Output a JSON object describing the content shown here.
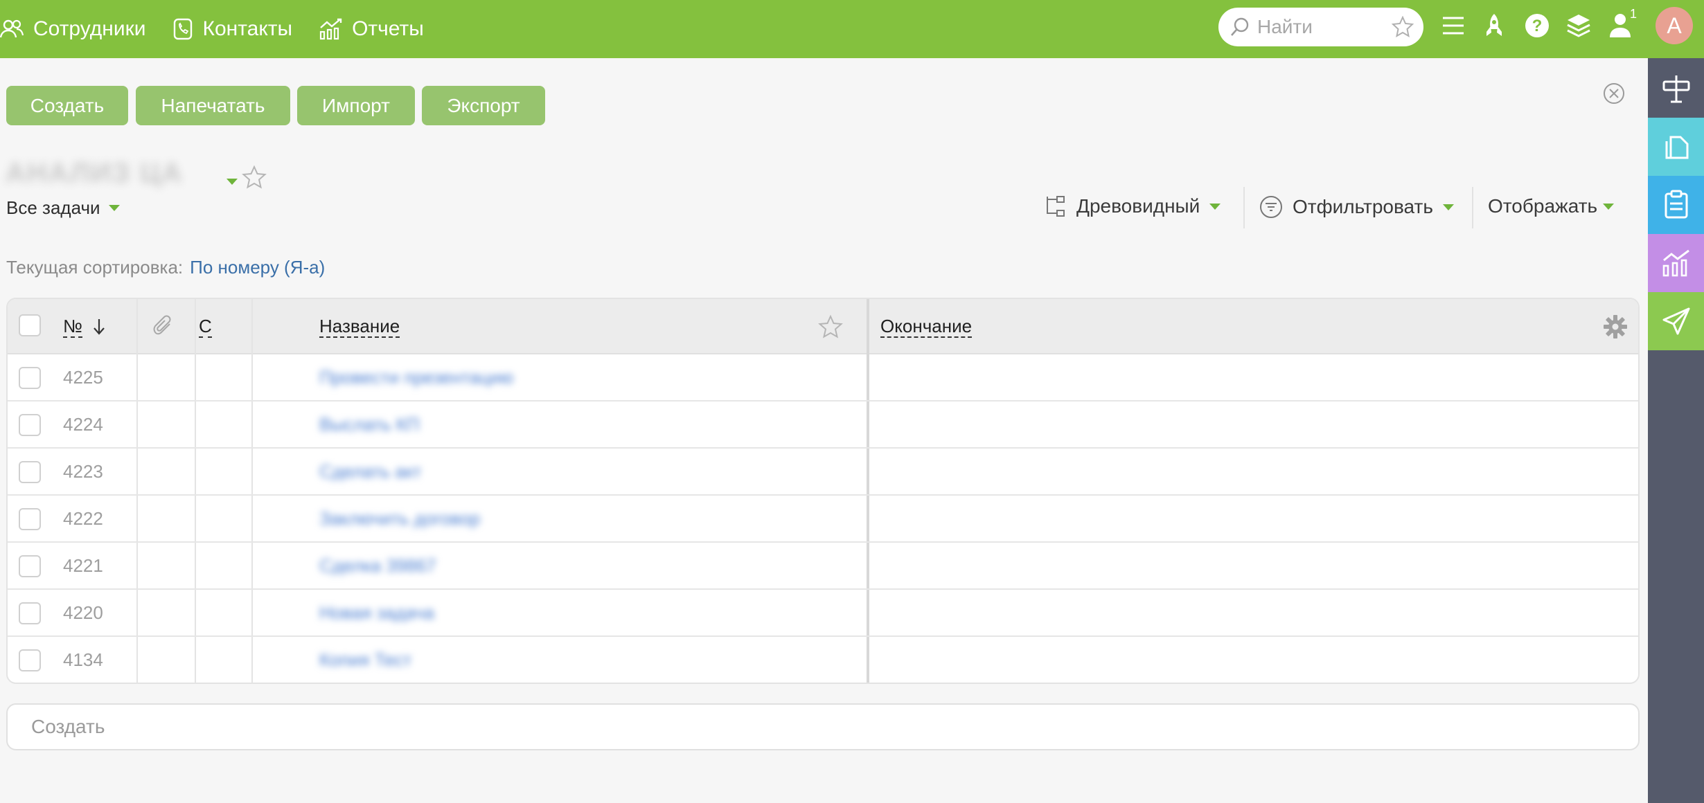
{
  "nav": {
    "employees": "Сотрудники",
    "contacts": "Контакты",
    "reports": "Отчеты"
  },
  "search": {
    "placeholder": "Найти"
  },
  "user": {
    "avatar_letter": "А",
    "notification_count": "1"
  },
  "toolbar": {
    "create": "Создать",
    "print": "Напечатать",
    "import": "Импорт",
    "export": "Экспорт"
  },
  "project": {
    "title": "АНАЛИЗ ЦА"
  },
  "filter": {
    "all_tasks": "Все задачи"
  },
  "view": {
    "tree": "Древовидный",
    "filter": "Отфильтровать",
    "display": "Отображать"
  },
  "sort": {
    "label": "Текущая сортировка:",
    "value": "По номеру (Я-а)"
  },
  "table": {
    "columns": {
      "number": "№",
      "c": "С",
      "name": "Название",
      "end": "Окончание"
    },
    "rows": [
      {
        "number": "4225",
        "name": "Провести презентацию"
      },
      {
        "number": "4224",
        "name": "Выслать КП"
      },
      {
        "number": "4223",
        "name": "Сделать акт"
      },
      {
        "number": "4222",
        "name": "Заключить договор"
      },
      {
        "number": "4221",
        "name": "Сделка 39867"
      },
      {
        "number": "4220",
        "name": "Новая задача"
      },
      {
        "number": "4134",
        "name": "Копия Тест"
      }
    ]
  },
  "quick_create": {
    "placeholder": "Создать"
  },
  "colors": {
    "topbar": "#84c13e",
    "button": "#97c46e",
    "rail": "#555a6b",
    "rail_teal": "#5fcfdc",
    "rail_blue": "#3fb2e8",
    "rail_purple": "#c38ee6",
    "rail_green": "#8cc950",
    "link": "#3a6fa8"
  }
}
